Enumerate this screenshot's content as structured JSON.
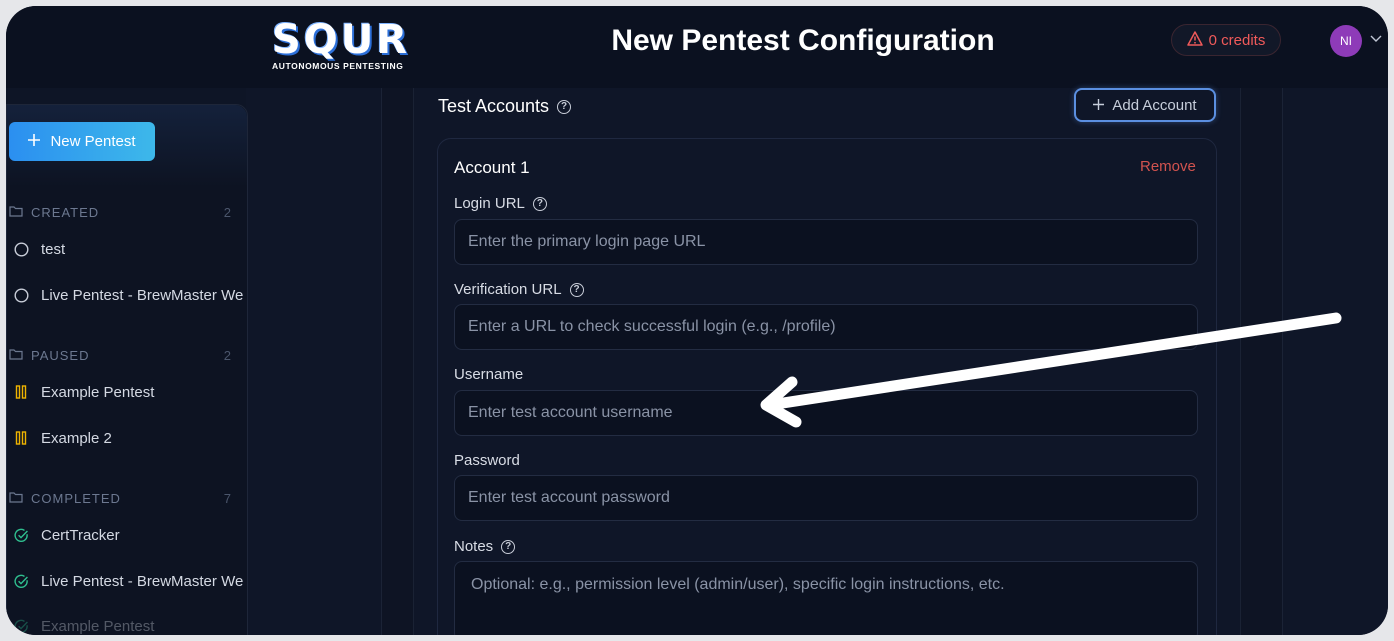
{
  "header": {
    "logo_text": "SQUR",
    "logo_subtext": "AUTONOMOUS PENTESTING",
    "title": "New Pentest Configuration",
    "credits_label": "0 credits",
    "avatar_initials": "NI"
  },
  "sidebar": {
    "new_button_label": "New Pentest",
    "groups": [
      {
        "label": "CREATED",
        "count": "2",
        "items": [
          {
            "label": "test",
            "status_icon": "circle-icon"
          },
          {
            "label": "Live Pentest - BrewMaster We",
            "status_icon": "circle-icon"
          }
        ]
      },
      {
        "label": "PAUSED",
        "count": "2",
        "items": [
          {
            "label": "Example Pentest",
            "status_icon": "pause-icon"
          },
          {
            "label": "Example 2",
            "status_icon": "pause-icon"
          }
        ]
      },
      {
        "label": "COMPLETED",
        "count": "7",
        "items": [
          {
            "label": "CertTracker",
            "status_icon": "check-circle-icon"
          },
          {
            "label": "Live Pentest - BrewMaster We",
            "status_icon": "check-circle-icon"
          },
          {
            "label": "Example Pentest",
            "status_icon": "check-circle-icon"
          }
        ]
      }
    ]
  },
  "form": {
    "section_title": "Test Accounts",
    "add_account_label": "Add Account",
    "account": {
      "title": "Account 1",
      "remove_label": "Remove",
      "login_url": {
        "label": "Login URL",
        "placeholder": "Enter the primary login page URL"
      },
      "verification_url": {
        "label": "Verification URL",
        "placeholder": "Enter a URL to check successful login (e.g., /profile)"
      },
      "username": {
        "label": "Username",
        "placeholder": "Enter test account username"
      },
      "password": {
        "label": "Password",
        "placeholder": "Enter test account password"
      },
      "notes": {
        "label": "Notes",
        "placeholder": "Optional: e.g., permission level (admin/user), specific login instructions, etc."
      }
    }
  },
  "colors": {
    "accent_blue": "#2b8ff0",
    "danger": "#d2534f",
    "paused": "#f0b400",
    "completed": "#2fbf8f",
    "avatar": "#8e3bb8"
  }
}
